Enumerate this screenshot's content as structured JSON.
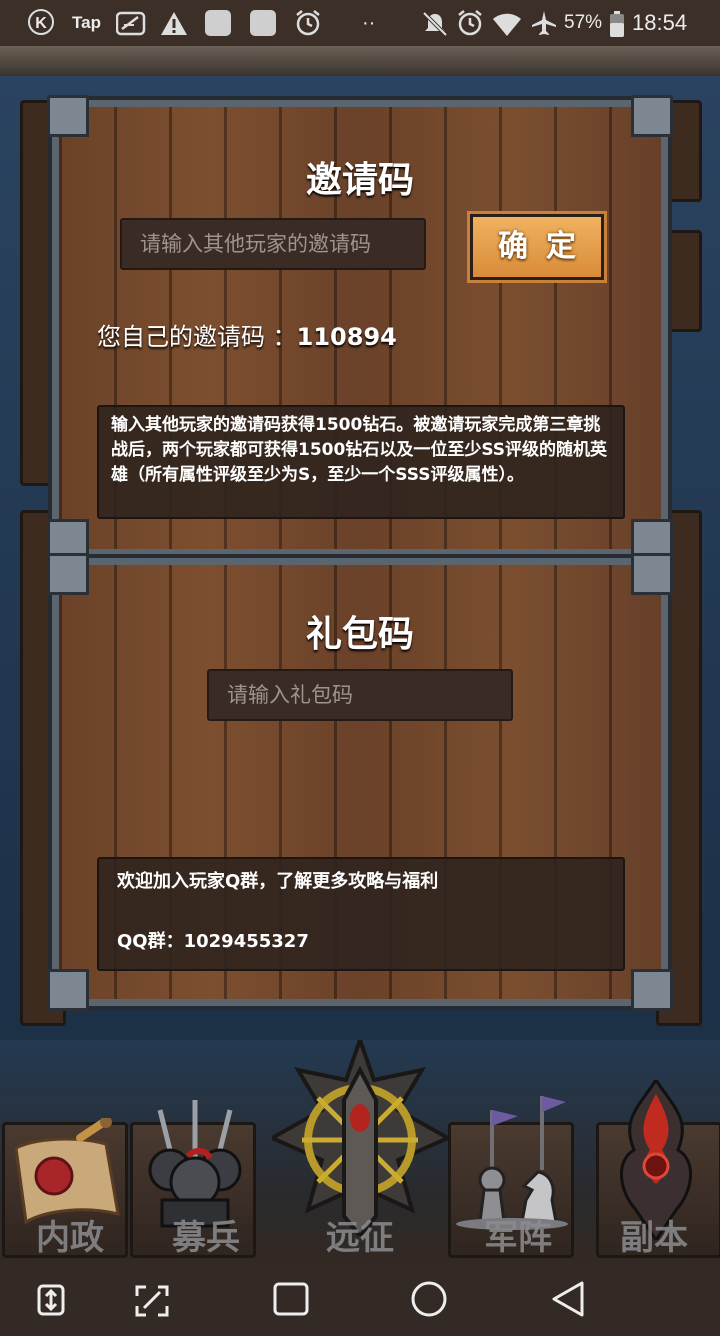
{
  "status_bar": {
    "k_icon": "K",
    "tap_label": "Tap",
    "icons": [
      "k-circle-icon",
      "tap-icon",
      "feather-icon",
      "warning-icon",
      "square-icon",
      "square-icon",
      "alarm-sync-icon",
      "more-dots-icon",
      "mute-icon",
      "alarm-icon",
      "wifi-icon",
      "airplane-icon",
      "battery-icon"
    ],
    "more_dots": "··",
    "battery_percent": "57%",
    "time": "18:54"
  },
  "invite_panel": {
    "title": "邀请码",
    "input_placeholder": "请输入其他玩家的邀请码",
    "confirm_label": "确定",
    "own_code_label": "您自己的邀请码 ：",
    "own_code_value": "110894",
    "description": "输入其他玩家的邀请码获得1500钻石。被邀请玩家完成第三章挑战后，两个玩家都可获得1500钻石以及一位至少SS评级的随机英雄（所有属性评级至少为S，至少一个SSS评级属性）。"
  },
  "gift_panel": {
    "title": "礼包码",
    "input_placeholder": "请输入礼包码",
    "info_line1": "欢迎加入玩家Q群，了解更多攻略与福利",
    "qq_label": "QQ群：",
    "qq_number": "1029455327"
  },
  "game_nav": {
    "items": [
      {
        "label": "内政",
        "icon": "scroll-seal-icon"
      },
      {
        "label": "募兵",
        "icon": "soldiers-icon"
      },
      {
        "label": "远征",
        "icon": "sword-emblem-icon"
      },
      {
        "label": "军阵",
        "icon": "chess-pieces-icon"
      },
      {
        "label": "副本",
        "icon": "dark-flame-icon"
      }
    ]
  },
  "android_nav": {
    "buttons": [
      "screen-rotate-icon",
      "screenshot-icon",
      "recents-square-icon",
      "home-circle-icon",
      "back-triangle-icon"
    ]
  },
  "colors": {
    "wood": "#6b4228",
    "frame": "#5a6570",
    "confirm_button": "#e09a45",
    "status_bar": "#3b2f28"
  }
}
